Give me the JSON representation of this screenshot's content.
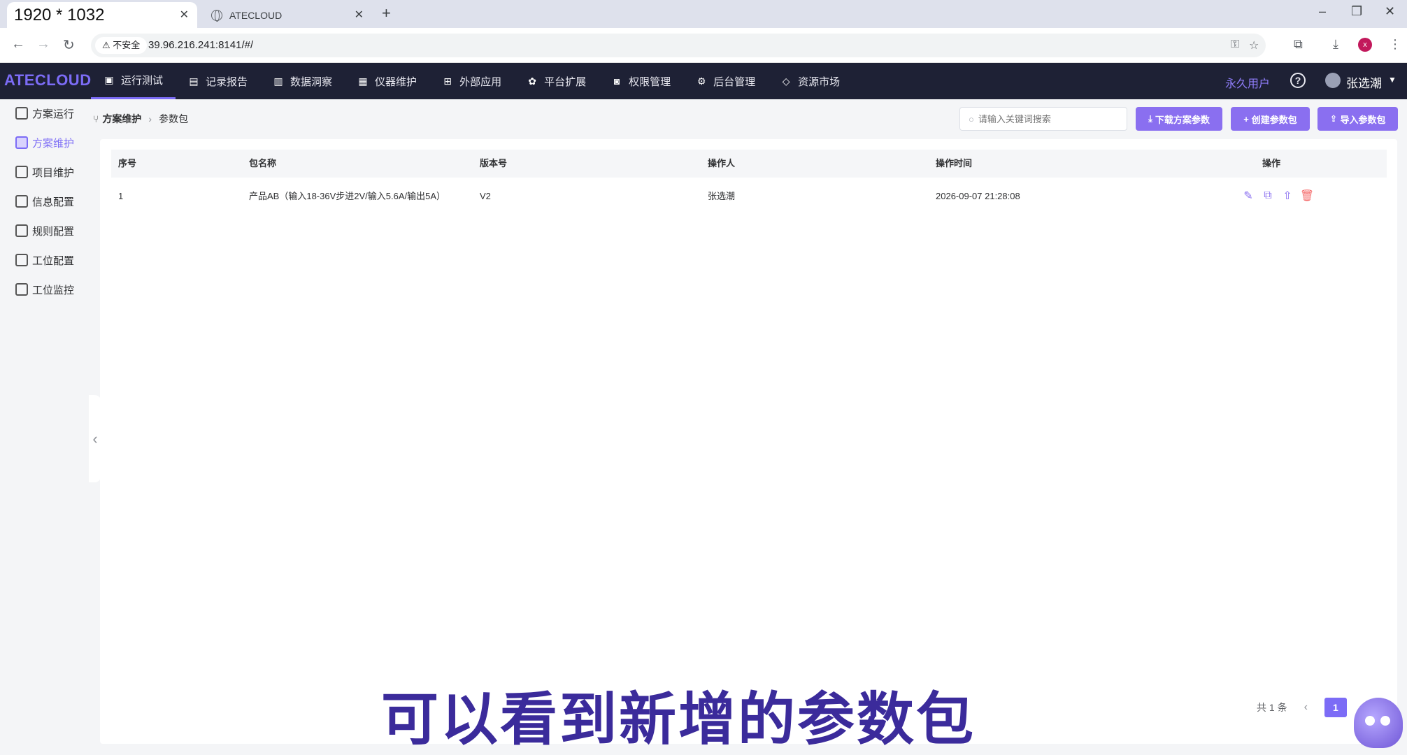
{
  "browser": {
    "active_tab_title": "1920 * 1032",
    "inactive_tab_title": "ATECLOUD",
    "insecure_label": "不安全",
    "url": "39.96.216.241:8141/#/"
  },
  "header": {
    "logo": "ATECLOUD",
    "nav": [
      {
        "label": "运行测试",
        "icon": "chart-icon"
      },
      {
        "label": "记录报告",
        "icon": "clipboard-icon"
      },
      {
        "label": "数据洞察",
        "icon": "monitor-icon"
      },
      {
        "label": "仪器维护",
        "icon": "keyboard-icon"
      },
      {
        "label": "外部应用",
        "icon": "grid-icon"
      },
      {
        "label": "平台扩展",
        "icon": "cluster-icon"
      },
      {
        "label": "权限管理",
        "icon": "robot-icon"
      },
      {
        "label": "后台管理",
        "icon": "gears-icon"
      },
      {
        "label": "资源市场",
        "icon": "tag-icon"
      }
    ],
    "active_nav_index": 0,
    "user_type": "永久用户",
    "user_name": "张选潮"
  },
  "sidebar": {
    "items": [
      {
        "label": "方案运行"
      },
      {
        "label": "方案维护"
      },
      {
        "label": "项目维护"
      },
      {
        "label": "信息配置"
      },
      {
        "label": "规则配置"
      },
      {
        "label": "工位配置"
      },
      {
        "label": "工位监控"
      }
    ],
    "active_index": 1
  },
  "breadcrumb": {
    "parent": "方案维护",
    "current": "参数包"
  },
  "toolbar": {
    "search_placeholder": "请输入关键词搜索",
    "download_label": "下载方案参数",
    "create_label": "创建参数包",
    "import_label": "导入参数包"
  },
  "table": {
    "headers": [
      "序号",
      "包名称",
      "版本号",
      "操作人",
      "操作时间",
      "操作"
    ],
    "rows": [
      {
        "index": "1",
        "name": "产品AB（输入18-36V步进2V/输入5.6A/输出5A）",
        "version": "V2",
        "operator": "张选潮",
        "time": "2026-09-07 21:28:08"
      }
    ]
  },
  "pagination": {
    "total_text": "共 1 条",
    "current_page": "1"
  },
  "caption": "可以看到新增的参数包",
  "colors": {
    "accent": "#7c6cf6",
    "header_bg": "#1e2135",
    "button": "#8a6ff0",
    "danger": "#f56c6c"
  }
}
